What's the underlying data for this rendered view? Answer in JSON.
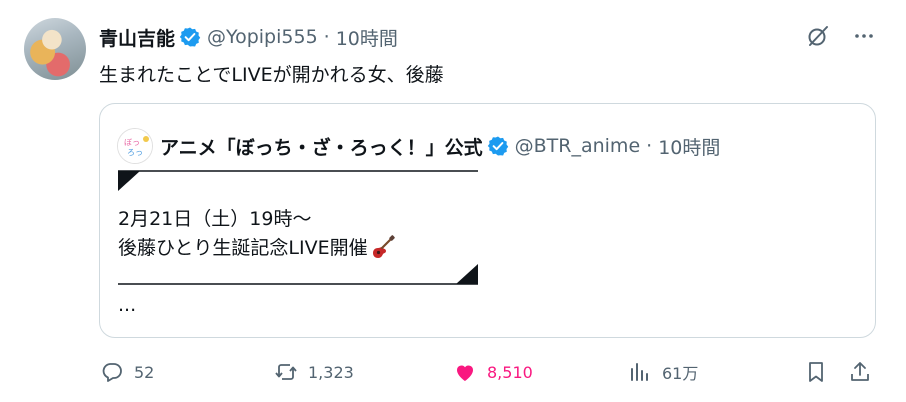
{
  "tweet": {
    "display_name": "青山吉能",
    "handle": "@Yopipi555",
    "separator": "·",
    "time": "10時間",
    "text": "生まれたことでLIVEが開かれる女、後藤"
  },
  "quote": {
    "display_name": "アニメ「ぼっち・ざ・ろっく！」公式",
    "handle": "@BTR_anime",
    "separator": "·",
    "time": "10時間",
    "line1": "2月21日（土）19時～",
    "line2": "後藤ひとり生誕記念LIVE開催",
    "ellipsis": "...",
    "avatar_text": "ぼっち・ざ・ろっく!"
  },
  "actions": {
    "replies": "52",
    "reposts": "1,323",
    "likes": "8,510",
    "views": "61万"
  },
  "colors": {
    "text": "#0f1419",
    "muted": "#536471",
    "verified": "#1d9bf0",
    "like": "#f91880",
    "border": "#cfd9de"
  },
  "icons": [
    "verified-badge-icon",
    "grok-icon",
    "more-icon",
    "guitar-emoji-icon",
    "reply-icon",
    "repost-icon",
    "like-icon",
    "views-icon",
    "bookmark-icon",
    "share-icon"
  ]
}
